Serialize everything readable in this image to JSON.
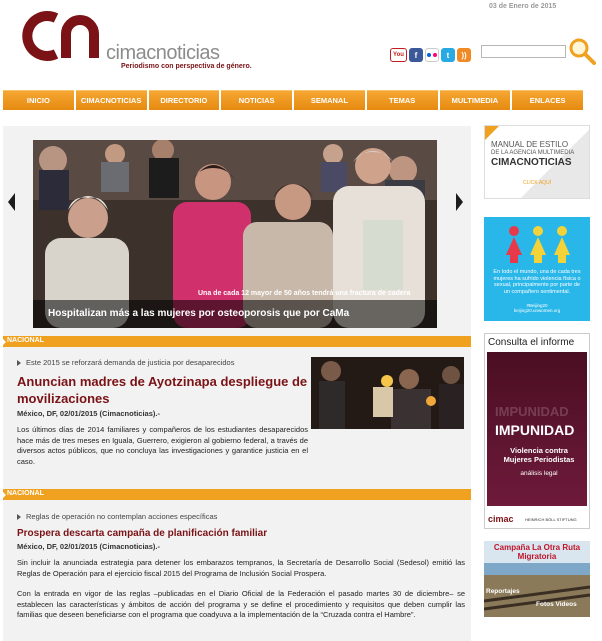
{
  "header": {
    "date": "03 de Enero de 2015",
    "logo_mark": "cn",
    "logo_word": "cimacnoticias",
    "tagline": "Periodismo con perspectiva de género.",
    "social": [
      "youtube-icon",
      "facebook-icon",
      "flickr-icon",
      "twitter-icon",
      "rss-icon"
    ],
    "search_placeholder": ""
  },
  "nav": {
    "items": [
      "INICIO",
      "CIMACNOTICIAS",
      "DIRECTORIO",
      "NOTICIAS",
      "SEMANAL",
      "TEMAS",
      "MULTIMEDIA",
      "ENLACES"
    ]
  },
  "slider": {
    "small_caption": "Una de cada 12 mayor de 50 años tendrá una fractura de cadera",
    "title": "Hospitalizan más a las mujeres por osteoporosis que por CaMa"
  },
  "articles": [
    {
      "section": "NACIONAL",
      "kicker": "Este 2015 se reforzará demanda de justicia por desaparecidos",
      "headline": "Anuncian madres de Ayotzinapa despliegue de movilizaciones",
      "dateline": "México, DF, 02/01/2015 (Cimacnoticias).-",
      "body": "Los últimos días de 2014 familiares y compañeros de los estudiantes desaparecidos hace más de tres meses en Iguala, Guerrero, exigieron al gobierno federal, a través de diversos actos públicos, que no concluya las investigaciones y garantice justicia en el caso."
    },
    {
      "section": "NACIONAL",
      "kicker": "Reglas de operación no contemplan acciones específicas",
      "headline": "Prospera descarta campaña de planificación familiar",
      "dateline": "México, DF, 02/01/2015 (Cimacnoticias).-",
      "body": "Sin incluir la anunciada estrategia para detener los embarazos tempranos, la Secretaría de Desarrollo Social (Sedesol) emitió las Reglas de Operación para el ejercicio fiscal 2015 del Programa de Inclusión Social Prospera.",
      "body2": "Con la entrada en vigor de las reglas –publicadas en el Diario Oficial de la Federación el pasado martes 30 de diciembre– se establecen las características y ámbitos de acción del programa y se define el procedimiento y requisitos que deben cumplir las familias que deseen beneficiarse con el programa que coadyuva a la implementación de la “Cruzada contra el Hambre”."
    }
  ],
  "sidebar": {
    "ad1": {
      "line1": "MANUAL DE ESTILO",
      "line2": "DE LA AGENCIA MULTIMEDIA",
      "line3": "CIMACNOTICIAS",
      "cta": "CLICK AQUÍ"
    },
    "ad2": {
      "text": "En todo el mundo, una de cada tres mujeres ha sufrido violencia física o sexual, principalmente por parte de un compañero sentimental.",
      "tags": "#Beijing20\nbeijing20.unwomen.org"
    },
    "ad3": {
      "heading": "Consulta el informe",
      "cover_bg": "IMPUNIDAD",
      "cover_title": "IMPUNIDAD",
      "subtitle": "Violencia contra Mujeres Periodistas",
      "sub2": "análisis legal",
      "logo1": "cimac",
      "logo2": "HEINRICH BÖLL STIFTUNG"
    },
    "ad4": {
      "title": "Campaña La Otra Ruta Migratoria",
      "left": "Reportajes",
      "right": "Fotos Videos"
    }
  },
  "colors": {
    "brand": "#7a1216",
    "nav": "#f0a120",
    "accent_blue": "#29b6e8"
  }
}
